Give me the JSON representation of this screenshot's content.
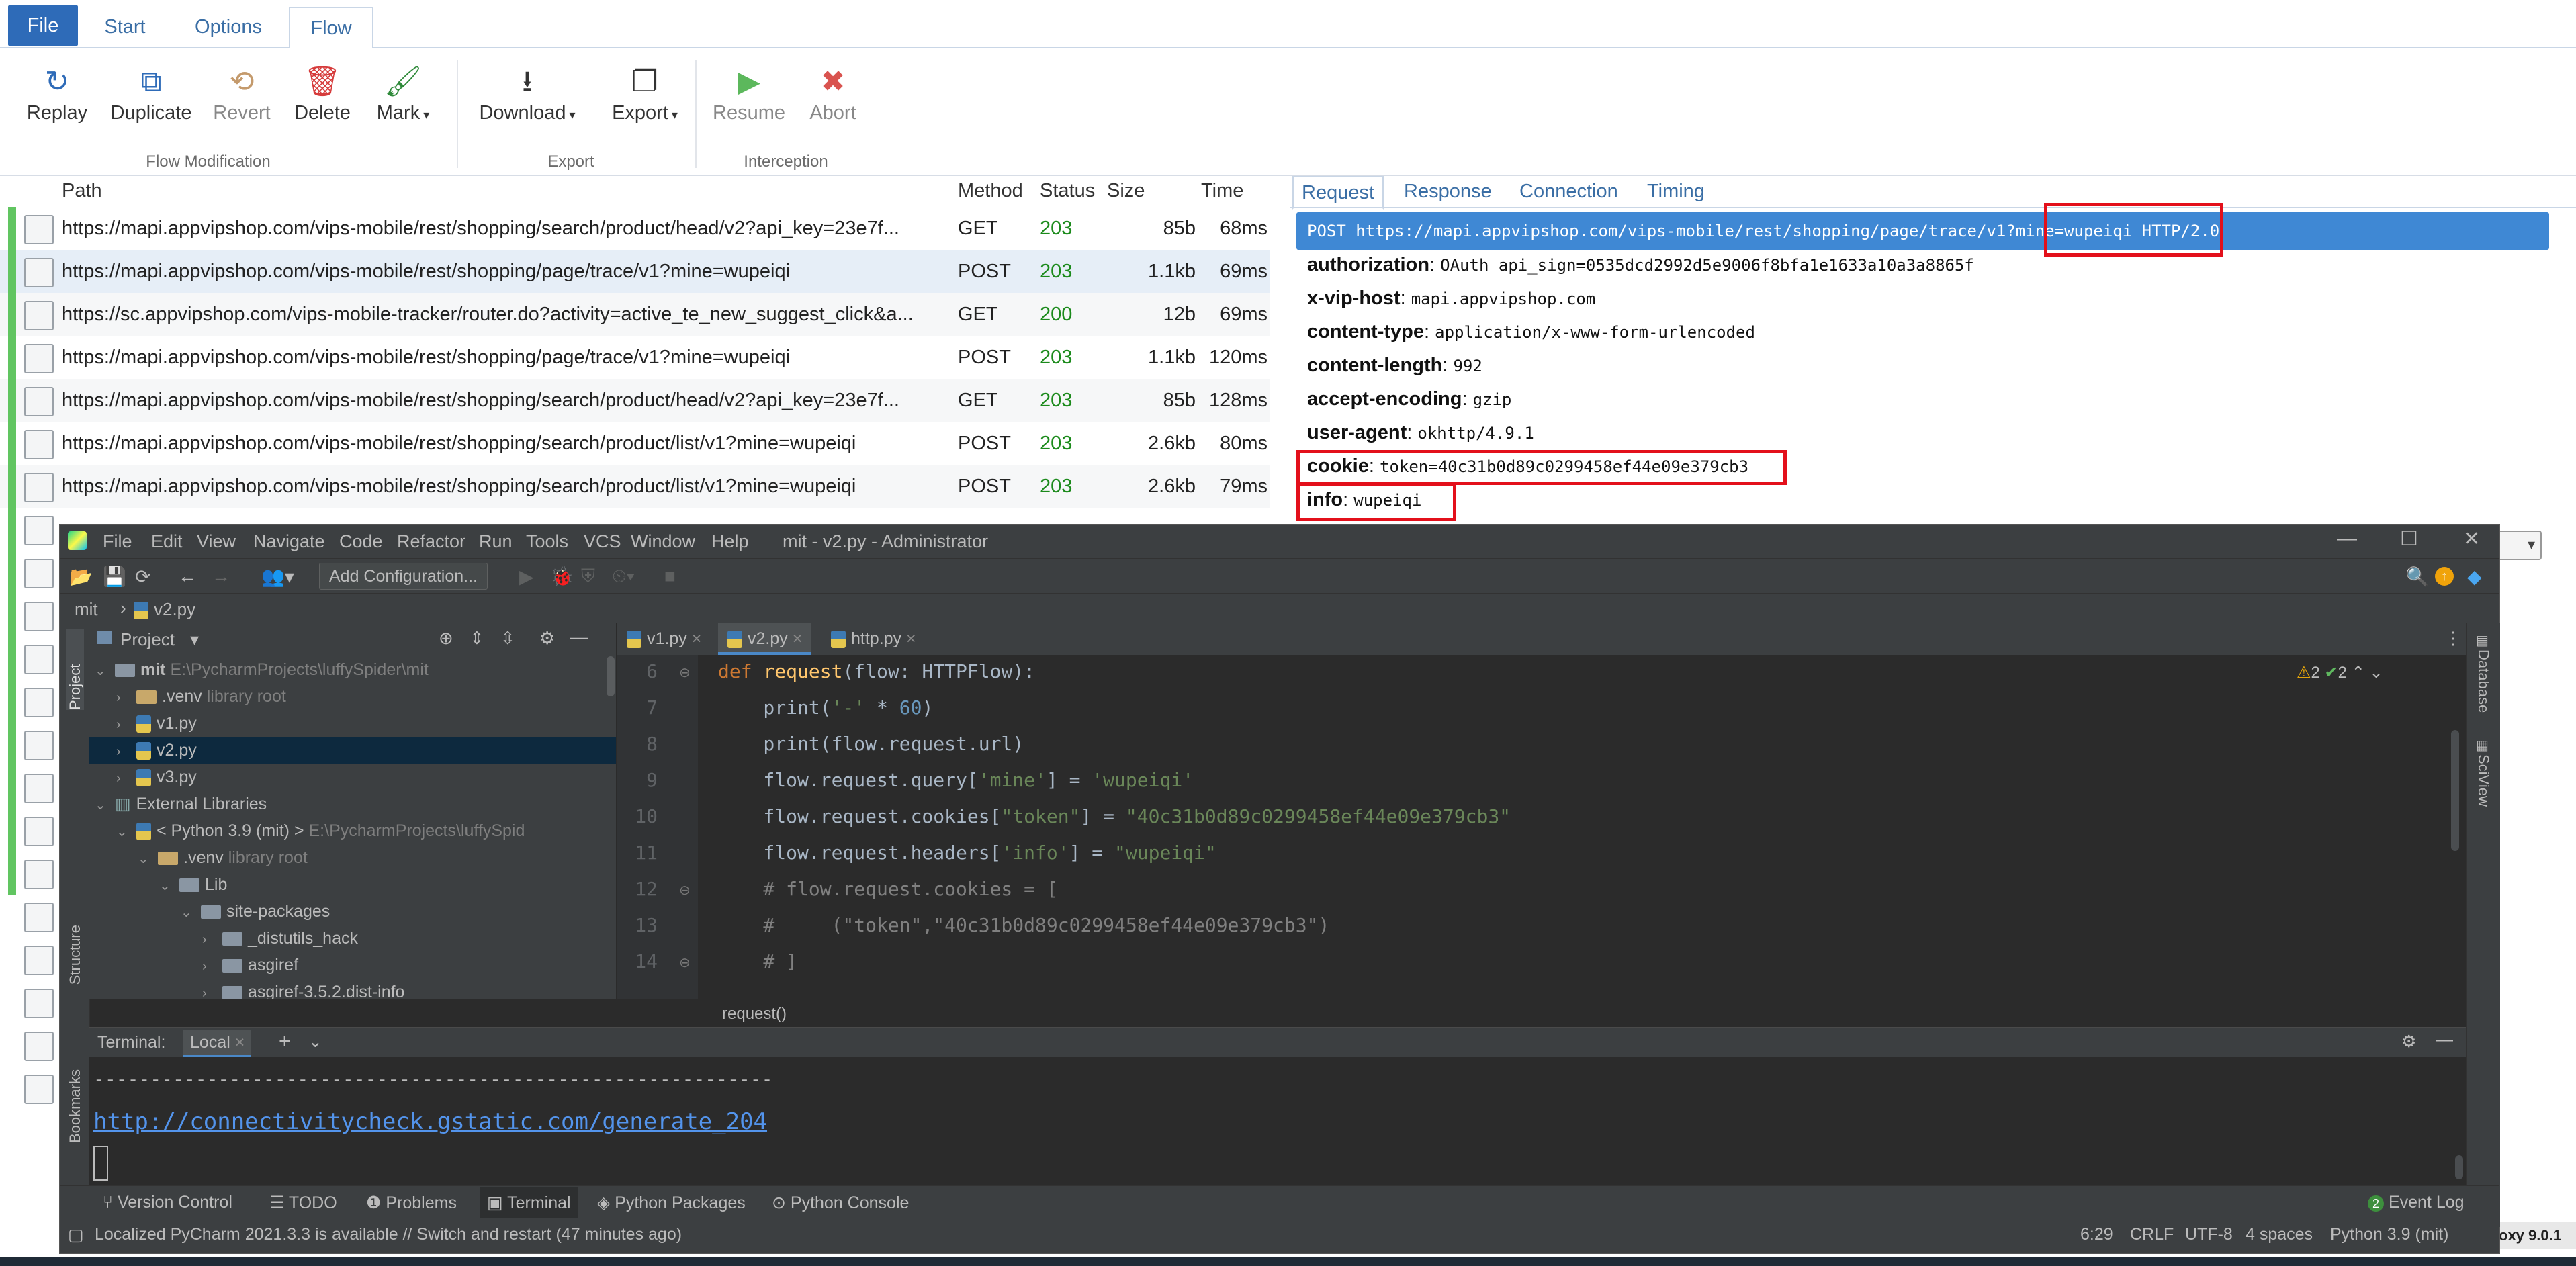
{
  "mitm": {
    "tabs": {
      "file": "File",
      "start": "Start",
      "options": "Options",
      "flow": "Flow"
    },
    "ribbon": {
      "replay": "Replay",
      "duplicate": "Duplicate",
      "revert": "Revert",
      "delete": "Delete",
      "mark": "Mark",
      "download": "Download",
      "export": "Export",
      "resume": "Resume",
      "abort": "Abort",
      "group_flow": "Flow Modification",
      "group_export": "Export",
      "group_interception": "Interception"
    },
    "columns": {
      "path": "Path",
      "method": "Method",
      "status": "Status",
      "size": "Size",
      "time": "Time"
    },
    "flows": [
      {
        "path": "https://mapi.appvipshop.com/vips-mobile/rest/shopping/search/product/head/v2?api_key=23e7f...",
        "method": "GET",
        "status": "203",
        "size": "85b",
        "time": "68ms"
      },
      {
        "path": "https://mapi.appvipshop.com/vips-mobile/rest/shopping/page/trace/v1?mine=wupeiqi",
        "method": "POST",
        "status": "203",
        "size": "1.1kb",
        "time": "69ms"
      },
      {
        "path": "https://sc.appvipshop.com/vips-mobile-tracker/router.do?activity=active_te_new_suggest_click&a...",
        "method": "GET",
        "status": "200",
        "size": "12b",
        "time": "69ms"
      },
      {
        "path": "https://mapi.appvipshop.com/vips-mobile/rest/shopping/page/trace/v1?mine=wupeiqi",
        "method": "POST",
        "status": "203",
        "size": "1.1kb",
        "time": "120ms"
      },
      {
        "path": "https://mapi.appvipshop.com/vips-mobile/rest/shopping/search/product/head/v2?api_key=23e7f...",
        "method": "GET",
        "status": "203",
        "size": "85b",
        "time": "128ms"
      },
      {
        "path": "https://mapi.appvipshop.com/vips-mobile/rest/shopping/search/product/list/v1?mine=wupeiqi",
        "method": "POST",
        "status": "203",
        "size": "2.6kb",
        "time": "80ms"
      },
      {
        "path": "https://mapi.appvipshop.com/vips-mobile/rest/shopping/search/product/list/v1?mine=wupeiqi",
        "method": "POST",
        "status": "203",
        "size": "2.6kb",
        "time": "79ms"
      }
    ],
    "detail": {
      "tabs": {
        "request": "Request",
        "response": "Response",
        "connection": "Connection",
        "timing": "Timing"
      },
      "request_line": "POST https://mapi.appvipshop.com/vips-mobile/rest/shopping/page/trace/v1?mine=wupeiqi HTTP/2.0",
      "headers": [
        {
          "k": "authorization",
          "v": "OAuth api_sign=0535dcd2992d5e9006f8bfa1e1633a10a3a8865f"
        },
        {
          "k": "x-vip-host",
          "v": "mapi.appvipshop.com"
        },
        {
          "k": "content-type",
          "v": "application/x-www-form-urlencoded"
        },
        {
          "k": "content-length",
          "v": "992"
        },
        {
          "k": "accept-encoding",
          "v": "gzip"
        },
        {
          "k": "user-agent",
          "v": "okhttp/4.9.1"
        },
        {
          "k": "cookie",
          "v": "token=40c31b0d89c0299458ef44e09e379cb3"
        },
        {
          "k": "info",
          "v": "wupeiqi"
        }
      ]
    },
    "status_version": "oxy 9.0.1"
  },
  "pycharm": {
    "title": "mit - v2.py - Administrator",
    "menu": [
      "File",
      "Edit",
      "View",
      "Navigate",
      "Code",
      "Refactor",
      "Run",
      "Tools",
      "VCS",
      "Window",
      "Help"
    ],
    "add_config": "Add Configuration...",
    "breadcrumb": {
      "project": "mit",
      "file": "v2.py"
    },
    "project_panel": {
      "title": "Project",
      "tree": [
        {
          "label": "mit",
          "hint": "E:\\PycharmProjects\\luffySpider\\mit"
        },
        {
          "label": ".venv",
          "hint": "library root"
        },
        {
          "label": "v1.py",
          "hint": ""
        },
        {
          "label": "v2.py",
          "hint": ""
        },
        {
          "label": "v3.py",
          "hint": ""
        },
        {
          "label": "External Libraries",
          "hint": ""
        },
        {
          "label": "< Python 3.9 (mit) >",
          "hint": "E:\\PycharmProjects\\luffySpid"
        },
        {
          "label": ".venv",
          "hint": "library root"
        },
        {
          "label": "Lib",
          "hint": ""
        },
        {
          "label": "site-packages",
          "hint": ""
        },
        {
          "label": "_distutils_hack",
          "hint": ""
        },
        {
          "label": "asgiref",
          "hint": ""
        },
        {
          "label": "asgiref-3.5.2.dist-info",
          "hint": ""
        }
      ]
    },
    "editor_tabs": [
      "v1.py",
      "v2.py",
      "http.py"
    ],
    "code": {
      "line_numbers": [
        "6",
        "7",
        "8",
        "9",
        "10",
        "11",
        "12",
        "13",
        "14"
      ],
      "l6_kw": "def ",
      "l6_fn": "request",
      "l6_rest": "(flow: HTTPFlow):",
      "l7_a": "    print(",
      "l7_s": "'-'",
      "l7_b": " * ",
      "l7_n": "60",
      "l7_c": ")",
      "l8": "    print(flow.request.url)",
      "l9_a": "    flow.request.query[",
      "l9_s1": "'mine'",
      "l9_b": "] = ",
      "l9_s2": "'wupeiqi'",
      "l10_a": "    flow.request.cookies[",
      "l10_s1": "\"token\"",
      "l10_b": "] = ",
      "l10_s2": "\"40c31b0d89c0299458ef44e09e379cb3\"",
      "l11_a": "    flow.request.headers[",
      "l11_s1": "'info'",
      "l11_b": "] = ",
      "l11_s2": "\"wupeiqi\"",
      "l12": "    # flow.request.cookies = [",
      "l13": "    #     (\"token\",\"40c31b0d89c0299458ef44e09e379cb3\")",
      "l14": "    # ]"
    },
    "inspections": {
      "warnings": "2",
      "ok": "2"
    },
    "code_crumb": "request()",
    "terminal": {
      "label": "Terminal:",
      "tab": "Local",
      "dashes": "------------------------------------------------------------",
      "link": "http://connectivitycheck.gstatic.com/generate_204"
    },
    "left_strip": {
      "project": "Project",
      "structure": "Structure",
      "bookmarks": "Bookmarks"
    },
    "right_strip": {
      "database": "Database",
      "sciview": "SciView"
    },
    "bottom_tabs": [
      "Version Control",
      "TODO",
      "Problems",
      "Terminal",
      "Python Packages",
      "Python Console"
    ],
    "event_log": "Event Log",
    "event_count": "2",
    "status": {
      "message": "Localized PyCharm 2021.3.3 is available // Switch and restart (47 minutes ago)",
      "pos": "6:29",
      "eol": "CRLF",
      "enc": "UTF-8",
      "indent": "4 spaces",
      "interp": "Python 3.9 (mit)"
    }
  },
  "colors": {
    "accent": "#2e6bb8",
    "highlight": "#3f88d4",
    "annotation": "#e3101b",
    "success": "#1b8a1b"
  }
}
